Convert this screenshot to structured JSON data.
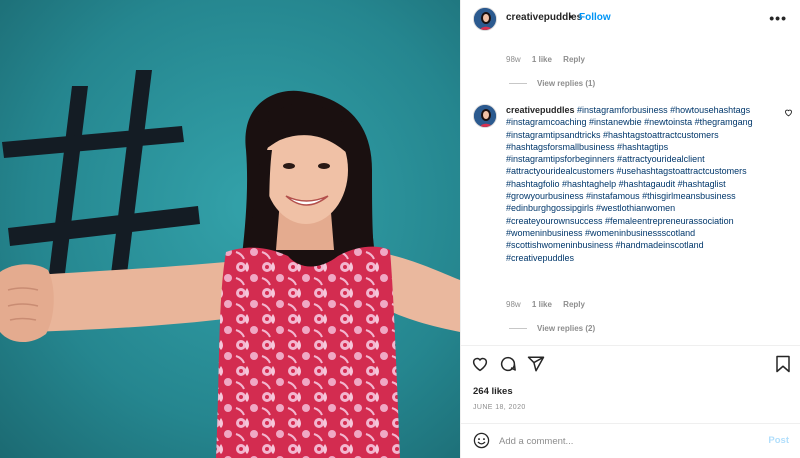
{
  "header": {
    "username": "creativepuddles",
    "separator": "•",
    "follow_label": "Follow",
    "more_icon": "more-options-icon",
    "more_glyph": "•••"
  },
  "prev_comment": {
    "age": "98w",
    "likes": "1 like",
    "reply_label": "Reply",
    "view_replies": "View replies (1)"
  },
  "comment": {
    "username": "creativepuddles",
    "text": "#instagramforbusiness #howtousehashtags #instagramcoaching #instanewbie #newtoinsta #thegramgang #instagramtipsandtricks #hashtagstoattractcustomers #hashtagsforsmallbusiness #hashtagtips #instagramtipsforbeginners #attractyouridealclient #attractyouridealcustomers #usehashtagstoattractcustomers #hashtagfolio #hashtaghelp #hashtagaudit #hashtaglist #growyourbusiness #instafamous #thisgirlmeansbusiness #edinburghgossipgirls #westlothianwomen #createyourownsuccess #femaleentrepreneurassociation #womeninbusiness #womeninbusinessscotland #scottishwomeninbusiness #handmadeinscotland #creativepuddles",
    "age": "98w",
    "likes": "1 like",
    "reply_label": "Reply",
    "view_replies": "View replies (2)"
  },
  "post": {
    "like_count": "264 likes",
    "date": "JUNE 18, 2020"
  },
  "composer": {
    "placeholder": "Add a comment...",
    "post_label": "Post"
  },
  "icons": {
    "like": "heart-icon",
    "comment": "comment-icon",
    "share": "share-icon",
    "save": "bookmark-icon",
    "emoji": "emoji-icon",
    "comment_like": "heart-icon"
  },
  "colors": {
    "link": "#00376b",
    "follow": "#0095f6",
    "post_disabled": "#b2dffc",
    "muted": "#8e8e8e",
    "photo_background": "#2a8e97",
    "dress": "#d8304f"
  }
}
